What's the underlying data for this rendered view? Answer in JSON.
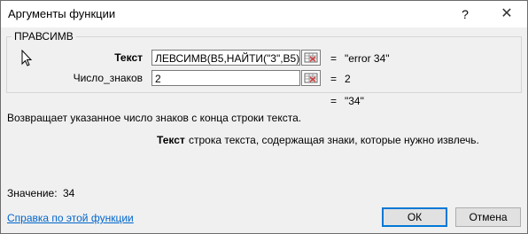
{
  "window": {
    "title": "Аргументы функции",
    "help_glyph": "?",
    "close_glyph": "✕"
  },
  "function": {
    "name": "ПРАВСИМВ",
    "args": [
      {
        "label": "Текст",
        "value": "ЛЕВСИМВ(B5,НАЙТИ(\"3\",B5)+1)",
        "result": "\"error 34\""
      },
      {
        "label": "Число_знаков",
        "value": "2",
        "result": "2"
      }
    ],
    "equals": "=",
    "formula_result": "\"34\""
  },
  "description": "Возвращает указанное число знаков с конца строки текста.",
  "arg_help": {
    "name": "Текст",
    "text": "строка текста, содержащая знаки, которые нужно извлечь."
  },
  "value": {
    "label": "Значение:",
    "result": "34"
  },
  "footer": {
    "help_link": "Справка по этой функции",
    "ok_label": "ОК",
    "cancel_label": "Отмена"
  },
  "colors": {
    "link": "#0066cc",
    "ok_border": "#0078d7"
  }
}
